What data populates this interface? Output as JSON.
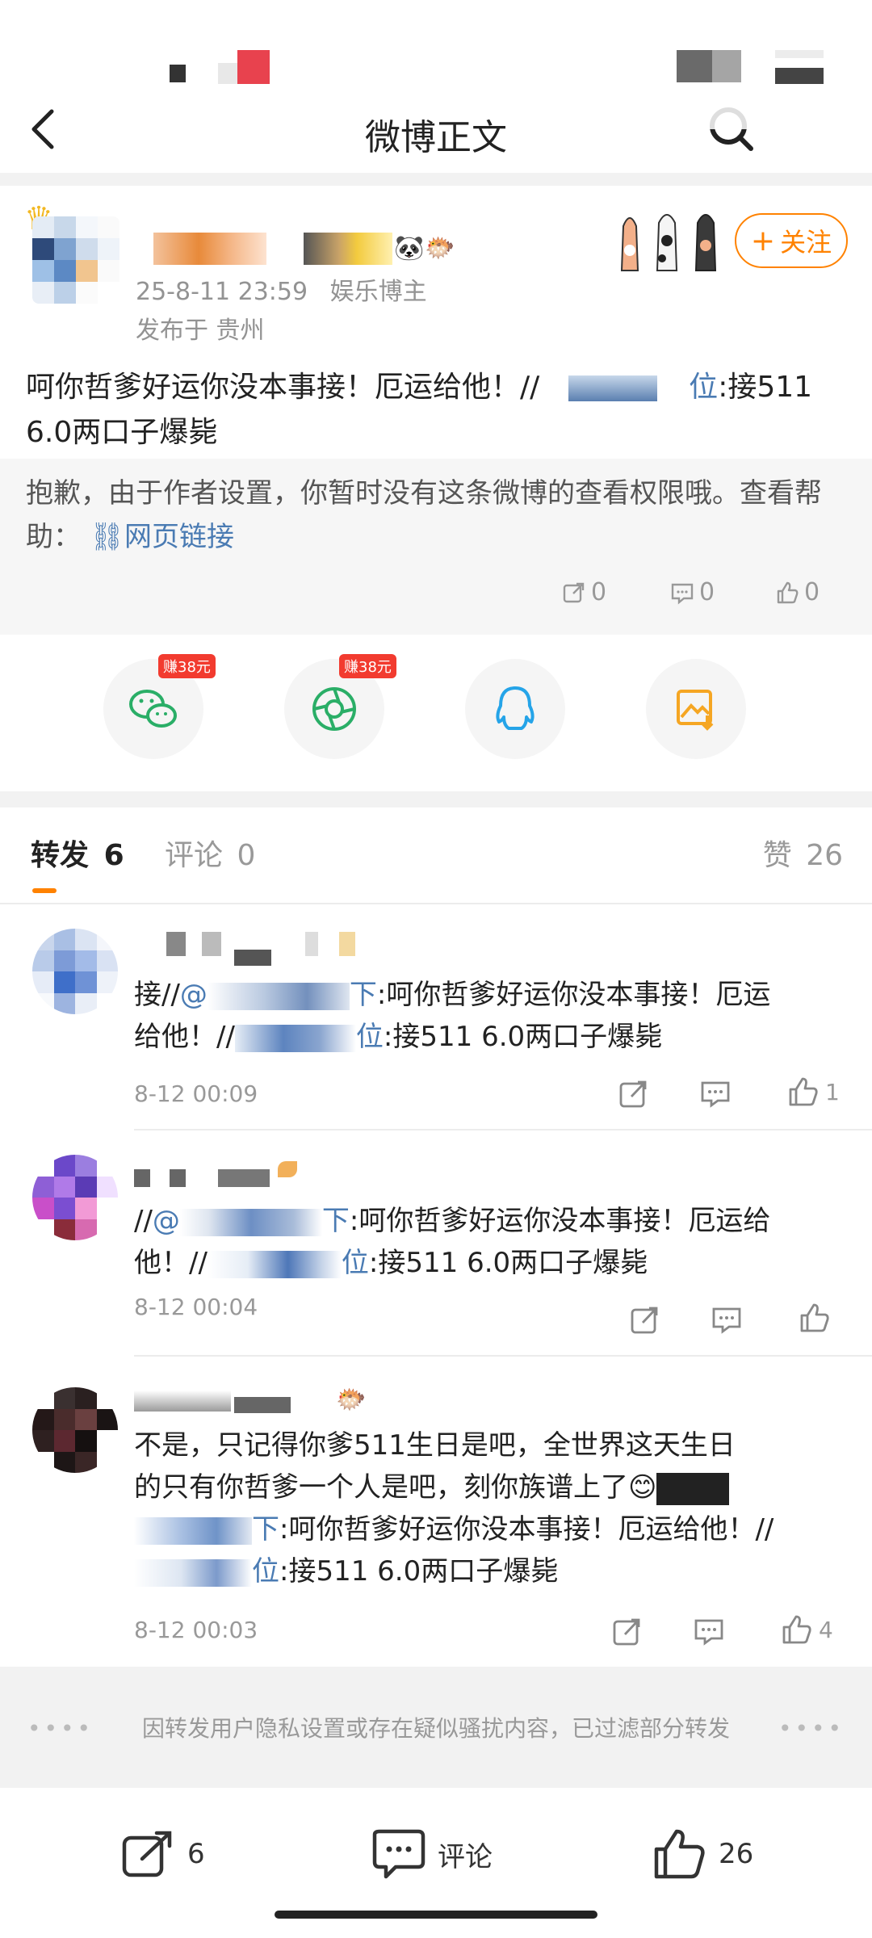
{
  "nav": {
    "title": "微博正文"
  },
  "post": {
    "timestamp": "25-8-11 23:59",
    "author_tag": "娱乐博主",
    "location": "发布于 贵州",
    "follow_label": "关注",
    "text_before": "呵你哲爹好运你没本事接！厄运给他！//",
    "mention_suffix": "位",
    "text_after": ":接511 6.0两口子爆毙"
  },
  "retweet_box": {
    "text": "抱歉，由于作者设置，你暂时没有这条微博的查看权限哦。查看帮助：",
    "link_label": "网页链接",
    "reposts": "0",
    "comments": "0",
    "likes": "0"
  },
  "share": {
    "earn_label": "赚38元"
  },
  "tabs": {
    "reposts_label": "转发",
    "reposts_count": "6",
    "comments_label": "评论",
    "comments_count": "0",
    "likes_label": "赞",
    "likes_count": "26"
  },
  "items": [
    {
      "line1_prefix": "接//",
      "line1_mention": "@",
      "line1_mention_end": "下",
      "line1_rest": ":呵你哲爹好运你没本事接！厄运",
      "line2_prefix": "给他！//",
      "line2_mention": "位",
      "line2_rest": ":接511 6.0两口子爆毙",
      "time": "8-12 00:09",
      "likes": "1"
    },
    {
      "line1_prefix": "//",
      "line1_mention": "@",
      "line1_mention_end": "下",
      "line1_rest": ":呵你哲爹好运你没本事接！厄运给",
      "line2_prefix": "他！//",
      "line2_mention": "位",
      "line2_rest": ":接511 6.0两口子爆毙",
      "time": "8-12 00:04",
      "likes": ""
    },
    {
      "line1": "不是，只记得你爹511生日是吧，全世界这天生日",
      "line2": "的只有你哲爹一个人是吧，刻你族谱上了",
      "line3_mention": "下",
      "line3_rest": ":呵你哲爹好运你没本事接！厄运给他！//",
      "line4_mention": "位",
      "line4_rest": ":接511 6.0两口子爆毙",
      "time": "8-12 00:03",
      "likes": "4"
    }
  ],
  "notice": {
    "text": "因转发用户隐私设置或存在疑似骚扰内容，已过滤部分转发"
  },
  "bottom_bar": {
    "repost_count": "6",
    "comment_label": "评论",
    "like_count": "26"
  },
  "colors": {
    "accent": "#ff8200",
    "link": "#4a7bb3",
    "muted": "#999999",
    "badge_red": "#f23b2f",
    "wechat_green": "#2aae67",
    "qq_blue": "#25a4e8",
    "save_orange": "#f5a623"
  }
}
